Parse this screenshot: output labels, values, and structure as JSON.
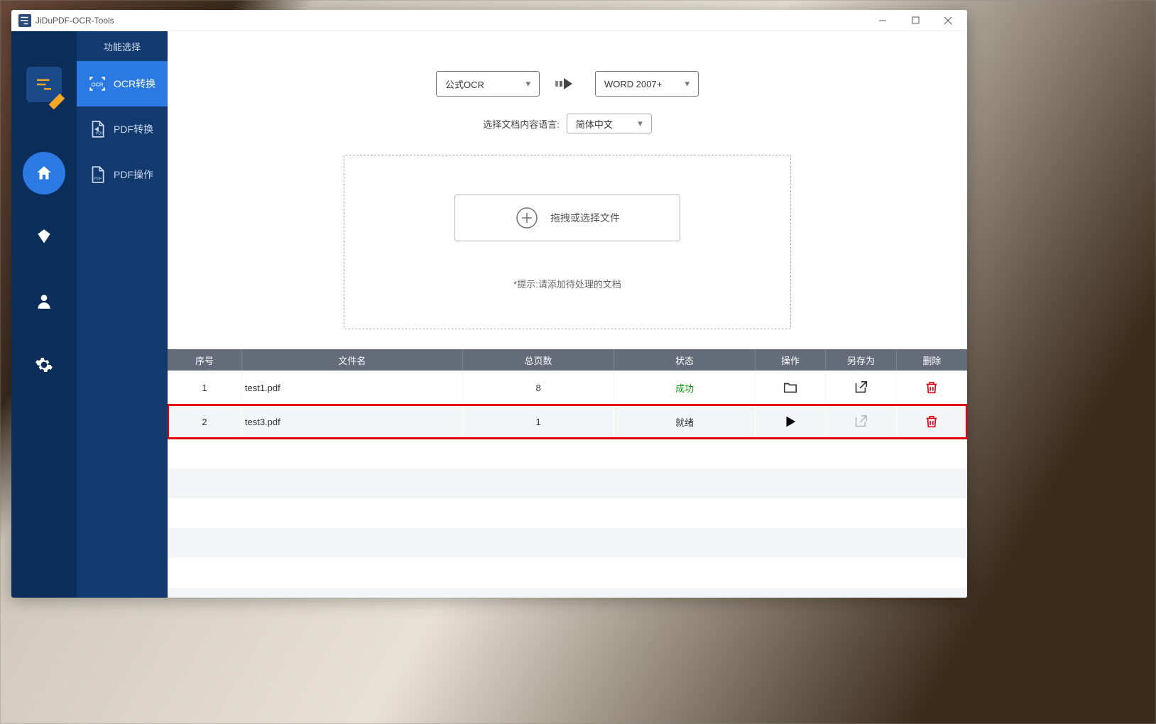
{
  "window": {
    "title": "JiDuPDF-OCR-Tools"
  },
  "sidebar": {
    "title": "功能选择",
    "items": [
      {
        "label": "OCR转换"
      },
      {
        "label": "PDF转换"
      },
      {
        "label": "PDF操作"
      }
    ]
  },
  "config": {
    "source_mode": "公式OCR",
    "target_format": "WORD 2007+",
    "lang_label": "选择文档内容语言:",
    "lang_value": "简体中文"
  },
  "dropzone": {
    "button_label": "拖拽或选择文件",
    "hint": "*提示:请添加待处理的文档"
  },
  "table": {
    "headers": {
      "idx": "序号",
      "name": "文件名",
      "pages": "总页数",
      "status": "状态",
      "op": "操作",
      "save": "另存为",
      "del": "删除"
    },
    "rows": [
      {
        "idx": "1",
        "name": "test1.pdf",
        "pages": "8",
        "status": "成功",
        "status_kind": "success",
        "op": "folder",
        "save_enabled": true,
        "highlight": false
      },
      {
        "idx": "2",
        "name": "test3.pdf",
        "pages": "1",
        "status": "就绪",
        "status_kind": "ready",
        "op": "play",
        "save_enabled": false,
        "highlight": true
      }
    ]
  }
}
